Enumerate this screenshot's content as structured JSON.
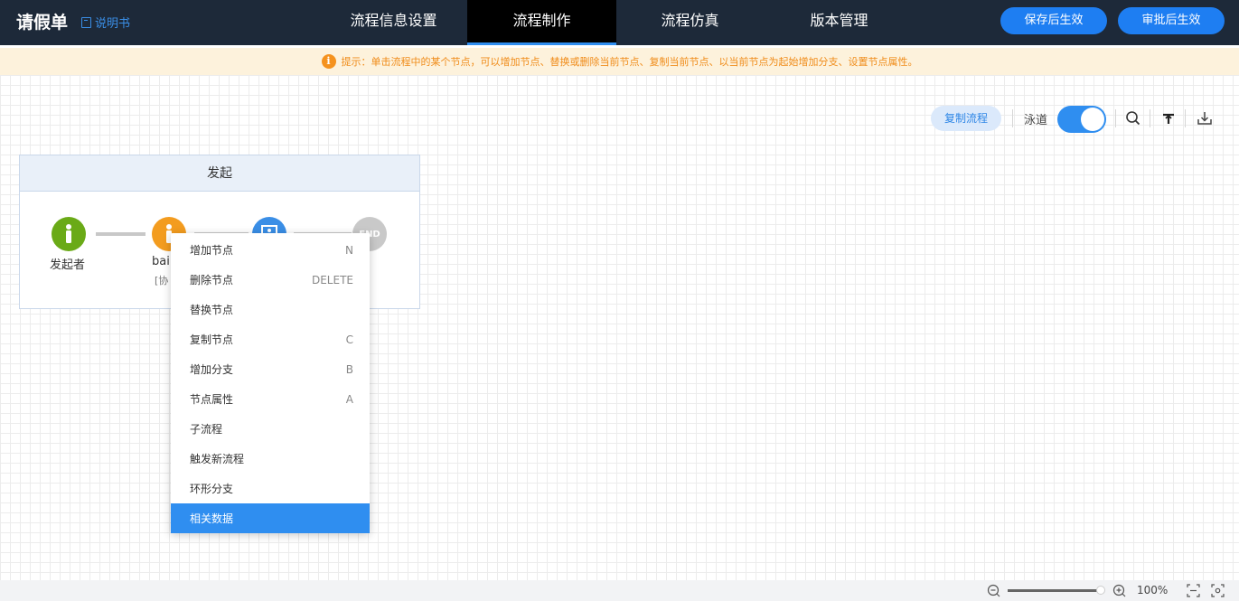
{
  "header": {
    "title": "请假单",
    "manual_label": "说明书",
    "tabs": [
      {
        "label": "流程信息设置",
        "active": false
      },
      {
        "label": "流程制作",
        "active": true
      },
      {
        "label": "流程仿真",
        "active": false
      },
      {
        "label": "版本管理",
        "active": false
      }
    ],
    "save_button": "保存后生效",
    "approve_button": "审批后生效"
  },
  "hint": {
    "text": "提示：单击流程中的某个节点，可以增加节点、替换或删除当前节点、复制当前节点、以当前节点为起始增加分支、设置节点属性。"
  },
  "toolbar": {
    "copy_flow_label": "复制流程",
    "lane_label": "泳道",
    "lane_toggle_on": true,
    "icons": [
      "search-icon",
      "align-top-icon",
      "download-icon"
    ]
  },
  "lane": {
    "title": "发起",
    "nodes": [
      {
        "label": "发起者",
        "sublabel": "",
        "type": "initiator",
        "color": "#6aaa17"
      },
      {
        "label": "bai",
        "sublabel": "[协",
        "type": "participant",
        "color": "#f39c1f"
      },
      {
        "label": "",
        "sublabel": "",
        "type": "task",
        "color": "#3a8ee6"
      },
      {
        "label": "END",
        "sublabel": "",
        "type": "end",
        "color": "#c9c9c9"
      }
    ]
  },
  "context_menu": {
    "items": [
      {
        "label": "增加节点",
        "shortcut": "N"
      },
      {
        "label": "删除节点",
        "shortcut": "DELETE"
      },
      {
        "label": "替换节点",
        "shortcut": ""
      },
      {
        "label": "复制节点",
        "shortcut": "C"
      },
      {
        "label": "增加分支",
        "shortcut": "B"
      },
      {
        "label": "节点属性",
        "shortcut": "A"
      },
      {
        "label": "子流程",
        "shortcut": ""
      },
      {
        "label": "触发新流程",
        "shortcut": ""
      },
      {
        "label": "环形分支",
        "shortcut": ""
      },
      {
        "label": "相关数据",
        "shortcut": "",
        "highlighted": true
      }
    ]
  },
  "status": {
    "zoom": "100%",
    "zoom_fraction": 1.0
  },
  "colors": {
    "header_bg": "#1d2939",
    "accent": "#2f8ef0",
    "hint_bg": "#fdf2dc",
    "hint_text": "#f08c1a"
  }
}
